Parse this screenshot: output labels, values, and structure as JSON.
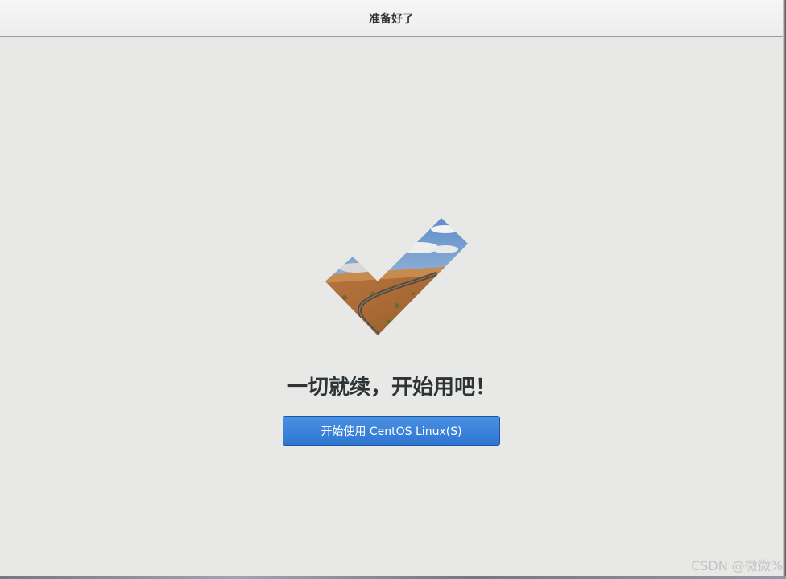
{
  "header": {
    "title": "准备好了"
  },
  "main": {
    "heading": "一切就续，开始用吧！",
    "start_button_label": "开始使用 CentOS Linux(S)",
    "checkmark_icon": "checkmark-icon"
  },
  "watermark": "CSDN @微微%",
  "colors": {
    "accent": "#3584e4",
    "background": "#e8e8e7",
    "text": "#2e3436"
  }
}
